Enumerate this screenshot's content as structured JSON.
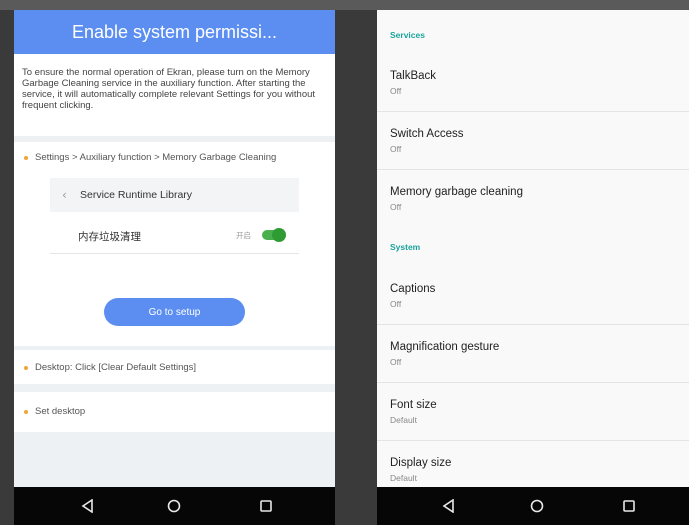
{
  "left": {
    "header_title": "Enable system permissi...",
    "intro": "To ensure the normal operation of Ekran, please turn on the Memory Garbage Cleaning service in the auxiliary function. After starting the service, it will automatically complete relevant Settings for you without frequent clicking.",
    "step1": "Settings > Auxiliary function > Memory Garbage Cleaning",
    "back_row_label": "Service Runtime Library",
    "toggle_row_label": "内存垃圾清理",
    "toggle_state_label": "开启",
    "setup_button": "Go to setup",
    "step2": "Desktop: Click [Clear Default Settings]",
    "step3": "Set desktop"
  },
  "right": {
    "section_services": "Services",
    "section_system": "System",
    "services": [
      {
        "title": "TalkBack",
        "value": "Off"
      },
      {
        "title": "Switch Access",
        "value": "Off"
      },
      {
        "title": "Memory garbage cleaning",
        "value": "Off"
      }
    ],
    "system": [
      {
        "title": "Captions",
        "value": "Off"
      },
      {
        "title": "Magnification gesture",
        "value": "Off"
      },
      {
        "title": "Font size",
        "value": "Default"
      },
      {
        "title": "Display size",
        "value": "Default"
      }
    ]
  },
  "nav": {
    "back_icon": "back-triangle-icon",
    "home_icon": "home-circle-icon",
    "recents_icon": "recents-square-icon"
  }
}
